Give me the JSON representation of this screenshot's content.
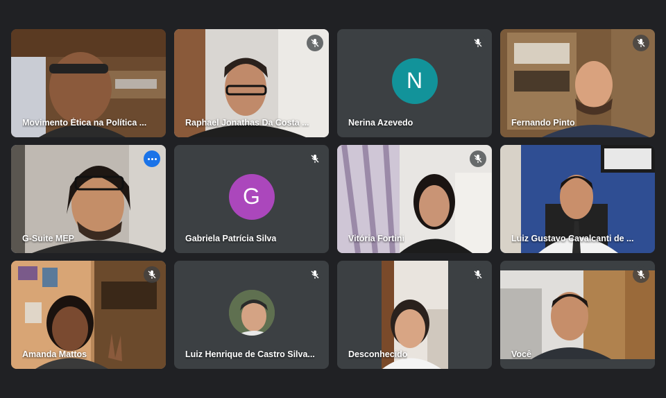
{
  "participants": [
    {
      "name": "Movimento Ética na Política ..."
    },
    {
      "name": "Raphael Jonathas Da Costa ..."
    },
    {
      "name": "Nerina Azevedo",
      "initial": "N",
      "avatar_color": "#12939a"
    },
    {
      "name": "Fernando Pinto"
    },
    {
      "name": "G-Suite MEP"
    },
    {
      "name": "Gabriela Patrícia Silva",
      "initial": "G",
      "avatar_color": "#ab47bc"
    },
    {
      "name": "Vitória Fortini"
    },
    {
      "name": "Luiz Gustavo Cavalcanti de ..."
    },
    {
      "name": "Amanda Mattos"
    },
    {
      "name": "Luiz Henrique de Castro Silva..."
    },
    {
      "name": "Desconhecido"
    },
    {
      "name": "Você"
    }
  ],
  "icons": {
    "muted": "mic-off-icon",
    "more": "more-options-icon"
  }
}
